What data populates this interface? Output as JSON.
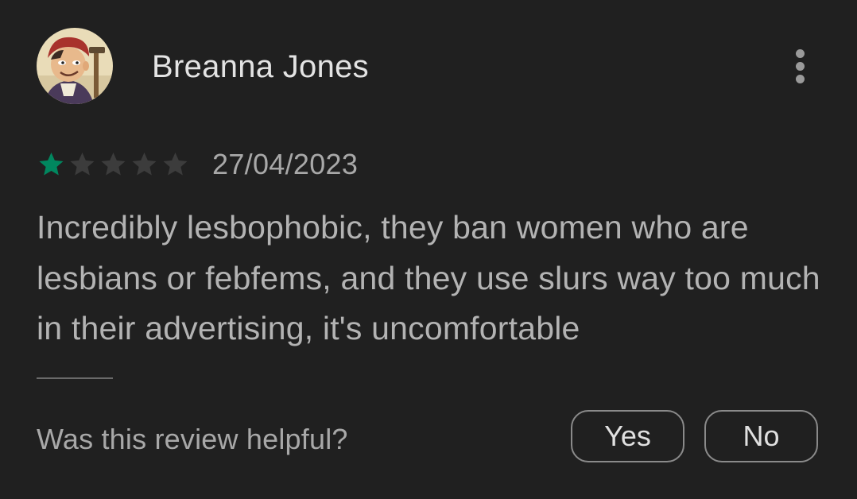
{
  "review": {
    "author": "Breanna Jones",
    "avatar_icon": "cartoon-character-avatar-icon",
    "more_options_icon": "more-vert-icon",
    "rating": 1,
    "rating_max": 5,
    "date": "27/04/2023",
    "text": "Incredibly lesbophobic, they ban women who are lesbians or febfems, and they use slurs way too much in their advertising, it's uncomfortable"
  },
  "helpful": {
    "question": "Was this review helpful?",
    "yes_label": "Yes",
    "no_label": "No"
  },
  "colors": {
    "background": "#202020",
    "star_filled": "#01875f",
    "star_empty": "#3c3c3c"
  }
}
